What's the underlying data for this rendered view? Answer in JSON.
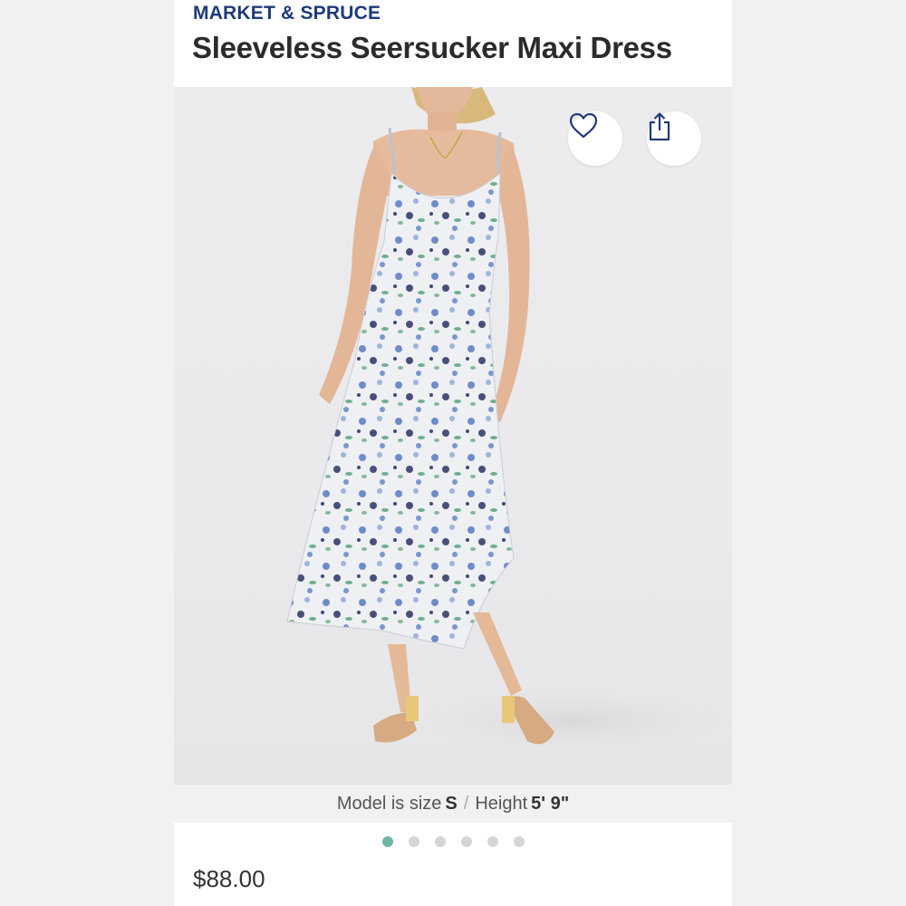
{
  "product": {
    "brand": "MARKET & SPRUCE",
    "title": "Sleeveless Seersucker Maxi Dress",
    "price": "$88.00"
  },
  "image": {
    "caption_prefix": "Model is size",
    "size_value": "S",
    "separator": "/",
    "height_label": "Height",
    "height_value": "5' 9\"",
    "total_images": 6,
    "active_index": 0
  },
  "actions": {
    "favorite_icon": "heart-icon",
    "share_icon": "share-icon"
  },
  "colors": {
    "brand": "#1f3a7a",
    "active_dot": "#6fb8a8",
    "inactive_dot": "#d6d6d8"
  }
}
